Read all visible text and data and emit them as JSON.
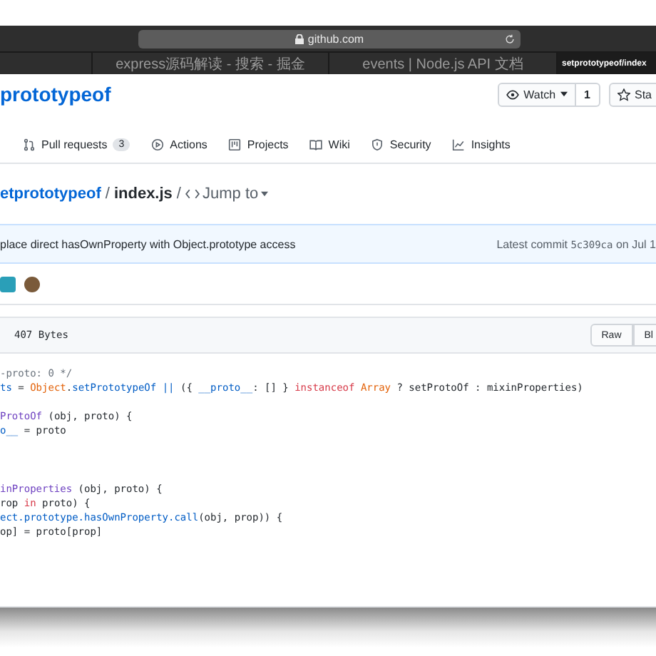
{
  "browser": {
    "address": "github.com",
    "tabs": [
      {
        "label": "express源码解读 - 搜索 - 掘金",
        "selected": false
      },
      {
        "label": "events | Node.js API 文档",
        "selected": false
      },
      {
        "label": "setprototypeof/index",
        "selected": true
      }
    ]
  },
  "repo": {
    "name": "prototypeof",
    "watch": {
      "label": "Watch",
      "count": "1"
    },
    "star": {
      "label": "Sta"
    }
  },
  "nav": [
    {
      "kind": "pulls",
      "label": "Pull requests",
      "count": "3"
    },
    {
      "kind": "actions",
      "label": "Actions"
    },
    {
      "kind": "projects",
      "label": "Projects"
    },
    {
      "kind": "wiki",
      "label": "Wiki"
    },
    {
      "kind": "security",
      "label": "Security"
    },
    {
      "kind": "insights",
      "label": "Insights"
    }
  ],
  "breadcrumb": {
    "repo": "etprototypeof",
    "separators": [
      "/",
      "/"
    ],
    "file": "index.js",
    "jump": "Jump to"
  },
  "commit": {
    "message": "place direct hasOwnProperty with Object.prototype access",
    "latest": "Latest commit",
    "sha": "5c309ca",
    "date": "on Jul 1"
  },
  "file": {
    "size": "407 Bytes",
    "buttons": [
      "Raw",
      "Bl"
    ]
  },
  "code": [
    {
      "kind": "code",
      "tokens": [
        {
          "kind": "comment",
          "text": "-proto: 0 */"
        }
      ]
    },
    {
      "kind": "code",
      "tokens": [
        {
          "kind": "const",
          "text": "ts"
        },
        {
          "kind": "plain",
          "text": " = "
        },
        {
          "kind": "builtin",
          "text": "Object"
        },
        {
          "kind": "plain",
          "text": "."
        },
        {
          "kind": "const",
          "text": "setPrototypeOf ||"
        },
        {
          "kind": "plain",
          "text": " ({ "
        },
        {
          "kind": "const",
          "text": "__proto__"
        },
        {
          "kind": "plain",
          "text": ": [] } "
        },
        {
          "kind": "keyword",
          "text": "instanceof "
        },
        {
          "kind": "builtin",
          "text": "Array"
        },
        {
          "kind": "plain",
          "text": " ? setProtoOf : mixinProperties)"
        }
      ]
    },
    {
      "kind": "blank"
    },
    {
      "kind": "code",
      "tokens": [
        {
          "kind": "func",
          "text": "ProtoOf"
        },
        {
          "kind": "plain",
          "text": " (obj, proto) {"
        }
      ]
    },
    {
      "kind": "code",
      "tokens": [
        {
          "kind": "const",
          "text": "o__"
        },
        {
          "kind": "plain",
          "text": " = proto"
        }
      ]
    },
    {
      "kind": "blank"
    },
    {
      "kind": "blank"
    },
    {
      "kind": "blank"
    },
    {
      "kind": "code",
      "tokens": [
        {
          "kind": "func",
          "text": "inProperties"
        },
        {
          "kind": "plain",
          "text": " (obj, proto) {"
        }
      ]
    },
    {
      "kind": "code",
      "tokens": [
        {
          "kind": "plain",
          "text": "rop "
        },
        {
          "kind": "keyword",
          "text": "in"
        },
        {
          "kind": "plain",
          "text": " proto) {"
        }
      ]
    },
    {
      "kind": "code",
      "tokens": [
        {
          "kind": "const",
          "text": "ect.prototype.hasOwnProperty.call"
        },
        {
          "kind": "plain",
          "text": "(obj, prop)) {"
        }
      ]
    },
    {
      "kind": "code",
      "tokens": [
        {
          "kind": "plain",
          "text": "op] = proto[prop]"
        }
      ]
    }
  ]
}
